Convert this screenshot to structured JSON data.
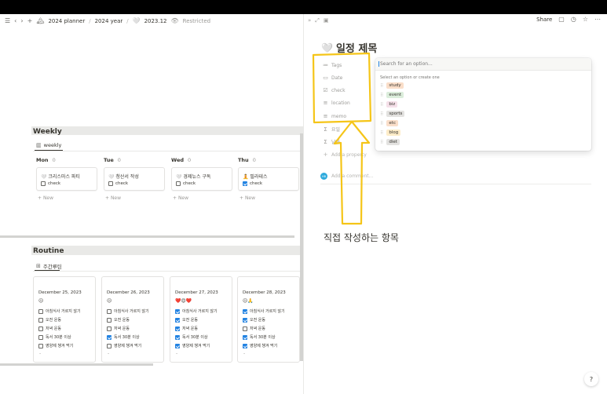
{
  "breadcrumb": {
    "items": [
      "2024 planner",
      "2024 year",
      "2023.12"
    ],
    "restricted": "Restricted"
  },
  "weekly": {
    "title": "Weekly",
    "view_tab": "weekly",
    "columns": [
      {
        "day": "Mon",
        "count": "0",
        "card_title": "크리스마스 파티",
        "check_label": "check",
        "checked": false,
        "new_label": "New"
      },
      {
        "day": "Tue",
        "count": "0",
        "card_title": "청산서 작성",
        "check_label": "check",
        "checked": false,
        "new_label": "New"
      },
      {
        "day": "Wed",
        "count": "0",
        "card_title": "경제뉴스 구독",
        "check_label": "check",
        "checked": false,
        "new_label": "New"
      },
      {
        "day": "Thu",
        "count": "0",
        "card_title": "필라테스",
        "check_label": "check",
        "checked": true,
        "new_label": "New"
      }
    ]
  },
  "routine": {
    "title": "Routine",
    "view_tab": "주간루틴",
    "cards": [
      {
        "date": "December 25, 2023",
        "emoji": "😐",
        "items": [
          {
            "label": "아침식사 거르지 않기",
            "checked": false
          },
          {
            "label": "오전 운동",
            "checked": false
          },
          {
            "label": "저녁 운동",
            "checked": false
          },
          {
            "label": "독서 30분 이상",
            "checked": false
          },
          {
            "label": "영양제 챙겨 먹기",
            "checked": false
          }
        ],
        "dash": "-"
      },
      {
        "date": "December 26, 2023",
        "emoji": "😐",
        "items": [
          {
            "label": "아침식사 거르지 않기",
            "checked": false
          },
          {
            "label": "오전 운동",
            "checked": false
          },
          {
            "label": "저녁 운동",
            "checked": false
          },
          {
            "label": "독서 30분 이상",
            "checked": true
          },
          {
            "label": "영양제 챙겨 먹기",
            "checked": false
          }
        ],
        "dash": "-"
      },
      {
        "date": "December 27, 2023",
        "emoji": "❤️😍❤️",
        "items": [
          {
            "label": "아침식사 거르지 않기",
            "checked": true
          },
          {
            "label": "오전 운동",
            "checked": true
          },
          {
            "label": "저녁 운동",
            "checked": true
          },
          {
            "label": "독서 30분 이상",
            "checked": true
          },
          {
            "label": "영양제 챙겨 먹기",
            "checked": true
          }
        ],
        "dash": "-"
      },
      {
        "date": "December 28, 2023",
        "emoji": "😐🙏",
        "items": [
          {
            "label": "아침식사 거르지 않기",
            "checked": true
          },
          {
            "label": "오전 운동",
            "checked": true
          },
          {
            "label": "저녁 운동",
            "checked": false
          },
          {
            "label": "독서 30분 이상",
            "checked": true
          },
          {
            "label": "영양제 챙겨 먹기",
            "checked": true
          }
        ],
        "dash": "-"
      }
    ]
  },
  "page": {
    "share_label": "Share",
    "title": "일정 제목",
    "properties": [
      "Tags",
      "Date",
      "check",
      "location",
      "memo",
      "요일",
      "날짜"
    ],
    "add_property": "Add a property",
    "add_comment": "Add a comment...",
    "avatar_initials": "HB"
  },
  "dropdown": {
    "placeholder": "Search for an option...",
    "hint": "Select an option or create one",
    "options": [
      {
        "label": "study",
        "color": "#fadec9"
      },
      {
        "label": "event",
        "color": "#dbeddb"
      },
      {
        "label": "biz",
        "color": "#f5e0e9"
      },
      {
        "label": "sports",
        "color": "#e3e2e0"
      },
      {
        "label": "etc",
        "color": "#fadec9"
      },
      {
        "label": "blog",
        "color": "#fdecc8"
      },
      {
        "label": "diet",
        "color": "#e3e2e0"
      }
    ]
  },
  "annotation": {
    "text": "직접 작성하는 항목",
    "color": "#f5c518"
  },
  "help_label": "?"
}
